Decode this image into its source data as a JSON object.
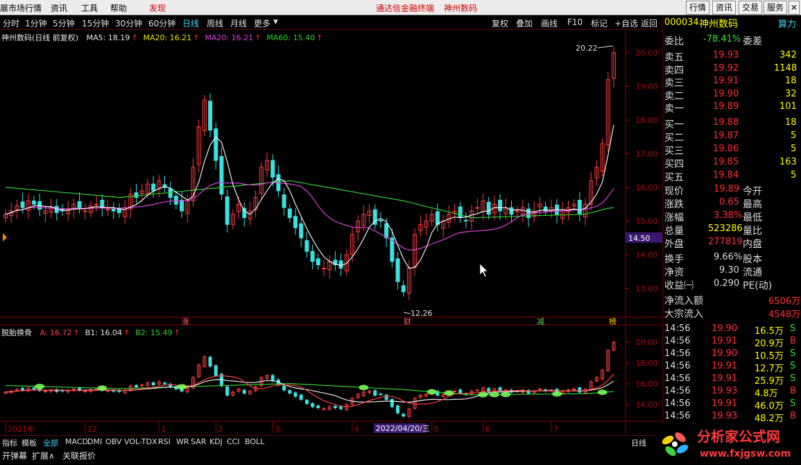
{
  "menu": {
    "items": [
      "展市场行情",
      "资讯",
      "工具",
      "帮助"
    ],
    "discover": "发现",
    "center_links": [
      "通达信金融终端",
      "神州数码"
    ],
    "right_buttons": [
      "行情",
      "资讯",
      "交易",
      "服务"
    ]
  },
  "period_tabs": [
    "分时",
    "1分钟",
    "5分钟",
    "15分钟",
    "30分钟",
    "60分钟",
    "日线",
    "周线",
    "月线",
    "更多"
  ],
  "active_period": "日线",
  "toolbar": [
    "复权",
    "叠加",
    "画线",
    "F10",
    "标记",
    "+自选",
    "返回"
  ],
  "main_legend": {
    "title": "神州数码(日线 前复权)",
    "items": [
      {
        "label": "MA5: 18.19",
        "color": "#e8e8e8"
      },
      {
        "label": "MA20: 16.21",
        "color": "#e8e800"
      },
      {
        "label": "MA20: 16.21",
        "color": "#e040e0"
      },
      {
        "label": "MA60: 15.40",
        "color": "#30d030"
      }
    ]
  },
  "sub_legend": {
    "title": "脱胎换骨",
    "items": [
      {
        "label": "A: 16.72",
        "color": "#ff4040"
      },
      {
        "label": "B1: 16.04",
        "color": "#e8e8e8"
      },
      {
        "label": "B2: 15.49",
        "color": "#30d030"
      }
    ]
  },
  "annotations": {
    "high": "20.22",
    "low": "12.26",
    "cursor_price": "14.50",
    "date_label": "2022/04/20/三"
  },
  "markers": [
    "涨",
    "财",
    "减",
    "榜"
  ],
  "price_axis": [
    "20.00",
    "19.00",
    "18.00",
    "17.00",
    "16.00",
    "15.00",
    "14.00",
    "13.00"
  ],
  "sub_axis": [
    "20.00",
    "18.00",
    "16.00",
    "14.00"
  ],
  "time_axis": [
    {
      "label": "2021年",
      "k": 0
    },
    {
      "label": "12",
      "k": 14
    },
    {
      "label": "1",
      "k": 27
    },
    {
      "label": "2",
      "k": 37
    },
    {
      "label": "3",
      "k": 47
    },
    {
      "label": "4",
      "k": 61
    },
    {
      "label": "5",
      "k": 75
    },
    {
      "label": "6",
      "k": 84
    },
    {
      "label": "7",
      "k": 96
    }
  ],
  "chart_data": {
    "type": "candlestick",
    "count": 108,
    "close": [
      15.2,
      15.3,
      15.45,
      15.4,
      15.6,
      15.5,
      15.35,
      15.3,
      15.4,
      15.25,
      15.3,
      15.35,
      15.5,
      15.4,
      15.3,
      15.45,
      15.5,
      15.4,
      15.35,
      15.3,
      15.25,
      15.4,
      15.8,
      15.7,
      15.9,
      16.1,
      15.9,
      16.2,
      16.0,
      15.7,
      15.5,
      15.3,
      15.6,
      16.6,
      17.8,
      18.6,
      17.7,
      16.8,
      15.8,
      14.9,
      15.2,
      15.5,
      15.1,
      15.3,
      15.7,
      16.6,
      16.8,
      16.3,
      15.9,
      15.4,
      15.1,
      14.8,
      14.5,
      14.1,
      13.8,
      13.7,
      13.6,
      13.8,
      13.7,
      13.6,
      14.0,
      14.6,
      15.0,
      15.2,
      15.3,
      14.9,
      15.0,
      14.5,
      13.8,
      13.2,
      12.9,
      13.6,
      14.6,
      14.9,
      15.0,
      15.2,
      14.9,
      15.0,
      15.2,
      15.3,
      15.1,
      15.0,
      15.3,
      15.4,
      15.6,
      15.2,
      15.5,
      15.3,
      15.4,
      15.2,
      15.3,
      15.4,
      15.1,
      15.3,
      15.5,
      15.3,
      15.4,
      15.2,
      15.3,
      15.4,
      15.5,
      15.2,
      15.5,
      16.2,
      16.6,
      17.3,
      19.2,
      20.0
    ],
    "ma60": [
      16.0,
      15.99,
      15.97,
      15.96,
      15.94,
      15.93,
      15.91,
      15.9,
      15.88,
      15.87,
      15.85,
      15.84,
      15.82,
      15.81,
      15.79,
      15.78,
      15.76,
      15.75,
      15.73,
      15.72,
      15.7,
      15.72,
      15.73,
      15.75,
      15.77,
      15.78,
      15.8,
      15.82,
      15.83,
      15.85,
      15.87,
      15.88,
      15.9,
      15.92,
      15.93,
      15.95,
      15.97,
      15.98,
      16.0,
      16.02,
      16.03,
      16.05,
      16.07,
      16.08,
      16.1,
      16.12,
      16.13,
      16.15,
      16.17,
      16.18,
      16.2,
      16.17,
      16.14,
      16.11,
      16.08,
      16.05,
      16.02,
      15.99,
      15.96,
      15.93,
      15.9,
      15.87,
      15.84,
      15.81,
      15.78,
      15.75,
      15.72,
      15.69,
      15.66,
      15.63,
      15.6,
      15.56,
      15.52,
      15.47,
      15.43,
      15.39,
      15.35,
      15.31,
      15.27,
      15.22,
      15.18,
      15.14,
      15.1,
      15.1,
      15.11,
      15.11,
      15.12,
      15.12,
      15.13,
      15.13,
      15.14,
      15.15,
      15.15,
      15.16,
      15.16,
      15.17,
      15.17,
      15.18,
      15.18,
      15.19,
      15.19,
      15.2,
      15.2,
      15.25,
      15.29,
      15.34,
      15.38,
      15.4
    ],
    "ylim": [
      12.0,
      21.0
    ]
  }
}
